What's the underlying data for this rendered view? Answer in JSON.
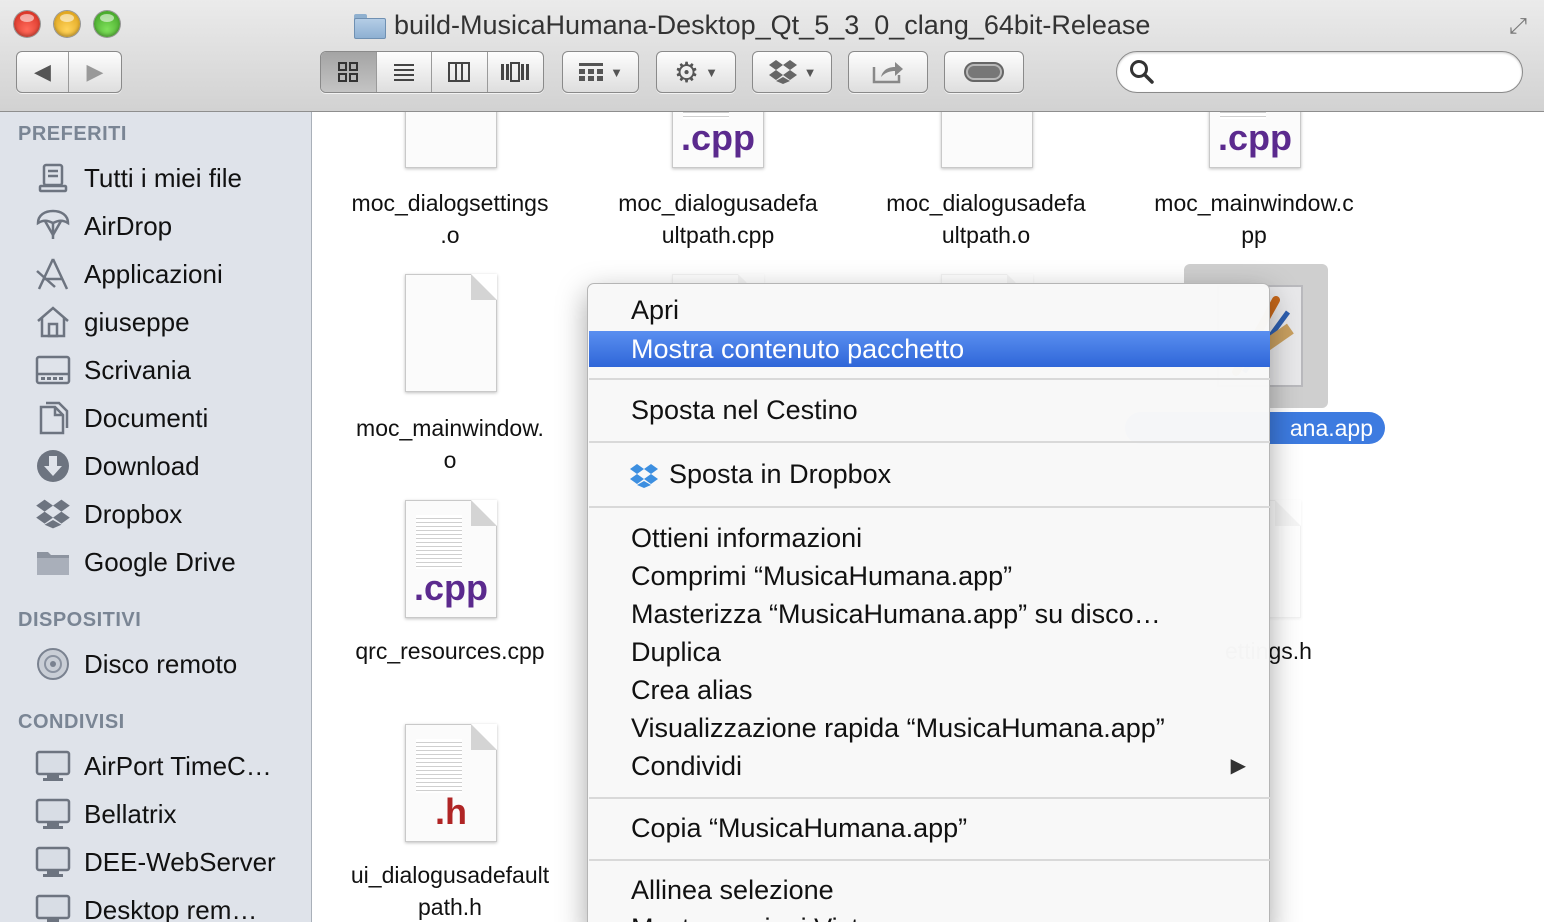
{
  "window": {
    "title": "build-MusicaHumana-Desktop_Qt_5_3_0_clang_64bit-Release"
  },
  "toolbar": {
    "back_icon": "chevron-left-icon",
    "forward_icon": "chevron-right-icon",
    "view_modes": [
      "icon-view",
      "list-view",
      "column-view",
      "cover-flow-view"
    ],
    "active_view": "icon-view",
    "search_placeholder": "",
    "search_value": ""
  },
  "sidebar": {
    "sections": [
      {
        "title": "PREFERITI",
        "items": [
          {
            "label": "Tutti i miei file",
            "icon": "all-files-icon"
          },
          {
            "label": "AirDrop",
            "icon": "airdrop-icon"
          },
          {
            "label": "Applicazioni",
            "icon": "applications-icon"
          },
          {
            "label": "giuseppe",
            "icon": "home-icon"
          },
          {
            "label": "Scrivania",
            "icon": "desktop-icon"
          },
          {
            "label": "Documenti",
            "icon": "documents-icon"
          },
          {
            "label": "Download",
            "icon": "download-icon"
          },
          {
            "label": "Dropbox",
            "icon": "dropbox-icon"
          },
          {
            "label": "Google Drive",
            "icon": "folder-icon"
          }
        ]
      },
      {
        "title": "DISPOSITIVI",
        "items": [
          {
            "label": "Disco remoto",
            "icon": "disc-icon"
          }
        ]
      },
      {
        "title": "CONDIVISI",
        "items": [
          {
            "label": "AirPort TimeC…",
            "icon": "network-display-icon"
          },
          {
            "label": "Bellatrix",
            "icon": "network-display-icon"
          },
          {
            "label": "DEE-WebServer",
            "icon": "network-display-icon"
          },
          {
            "label": "Desktop rem…",
            "icon": "network-display-icon"
          }
        ]
      }
    ]
  },
  "files": [
    {
      "line1": "moc_dialogsettings",
      "line2": ".o",
      "type": "o"
    },
    {
      "line1": "moc_dialogusadefa",
      "line2": "ultpath.cpp",
      "type": "cpp"
    },
    {
      "line1": "moc_dialogusadefa",
      "line2": "ultpath.o",
      "type": "o"
    },
    {
      "line1": "moc_mainwindow.c",
      "line2": "pp",
      "type": "cpp"
    },
    {
      "line1": "moc_mainwindow.",
      "line2": "o",
      "type": "o"
    },
    {
      "line1": "MusicaHumana.app",
      "line2": "",
      "label_visible": "ana.app",
      "type": "app",
      "selected": true
    },
    {
      "line1": "qrc_resources.cpp",
      "line2": "",
      "type": "cpp"
    },
    {
      "line1": "ui_dialogsettings.h",
      "line2": "",
      "label_visible": "ettings.h",
      "type": "h"
    },
    {
      "line1": "ui_dialogusadefault",
      "line2": "path.h",
      "type": "h"
    }
  ],
  "file_icon_ext": {
    "cpp": ".cpp",
    "h": ".h"
  },
  "context_menu": {
    "items": [
      {
        "label": "Apri"
      },
      {
        "label": "Mostra contenuto pacchetto",
        "highlighted": true
      },
      {
        "label": "Sposta nel Cestino"
      },
      {
        "label": "Sposta in Dropbox",
        "icon": "dropbox-icon"
      },
      {
        "label": "Ottieni informazioni"
      },
      {
        "label": "Comprimi “MusicaHumana.app”"
      },
      {
        "label": "Masterizza “MusicaHumana.app” su disco…"
      },
      {
        "label": "Duplica"
      },
      {
        "label": "Crea alias"
      },
      {
        "label": "Visualizzazione rapida “MusicaHumana.app”"
      },
      {
        "label": "Condividi",
        "submenu": true
      },
      {
        "label": "Copia “MusicaHumana.app”"
      },
      {
        "label": "Allinea selezione"
      },
      {
        "label": "Mostra opzioni Vista"
      }
    ]
  },
  "colors": {
    "selection_blue": "#3d7be0",
    "menu_highlight": "#2f66d8",
    "sidebar_bg": "#dfe3ea",
    "cpp_ext": "#5b2a8e",
    "h_ext": "#b02525"
  }
}
